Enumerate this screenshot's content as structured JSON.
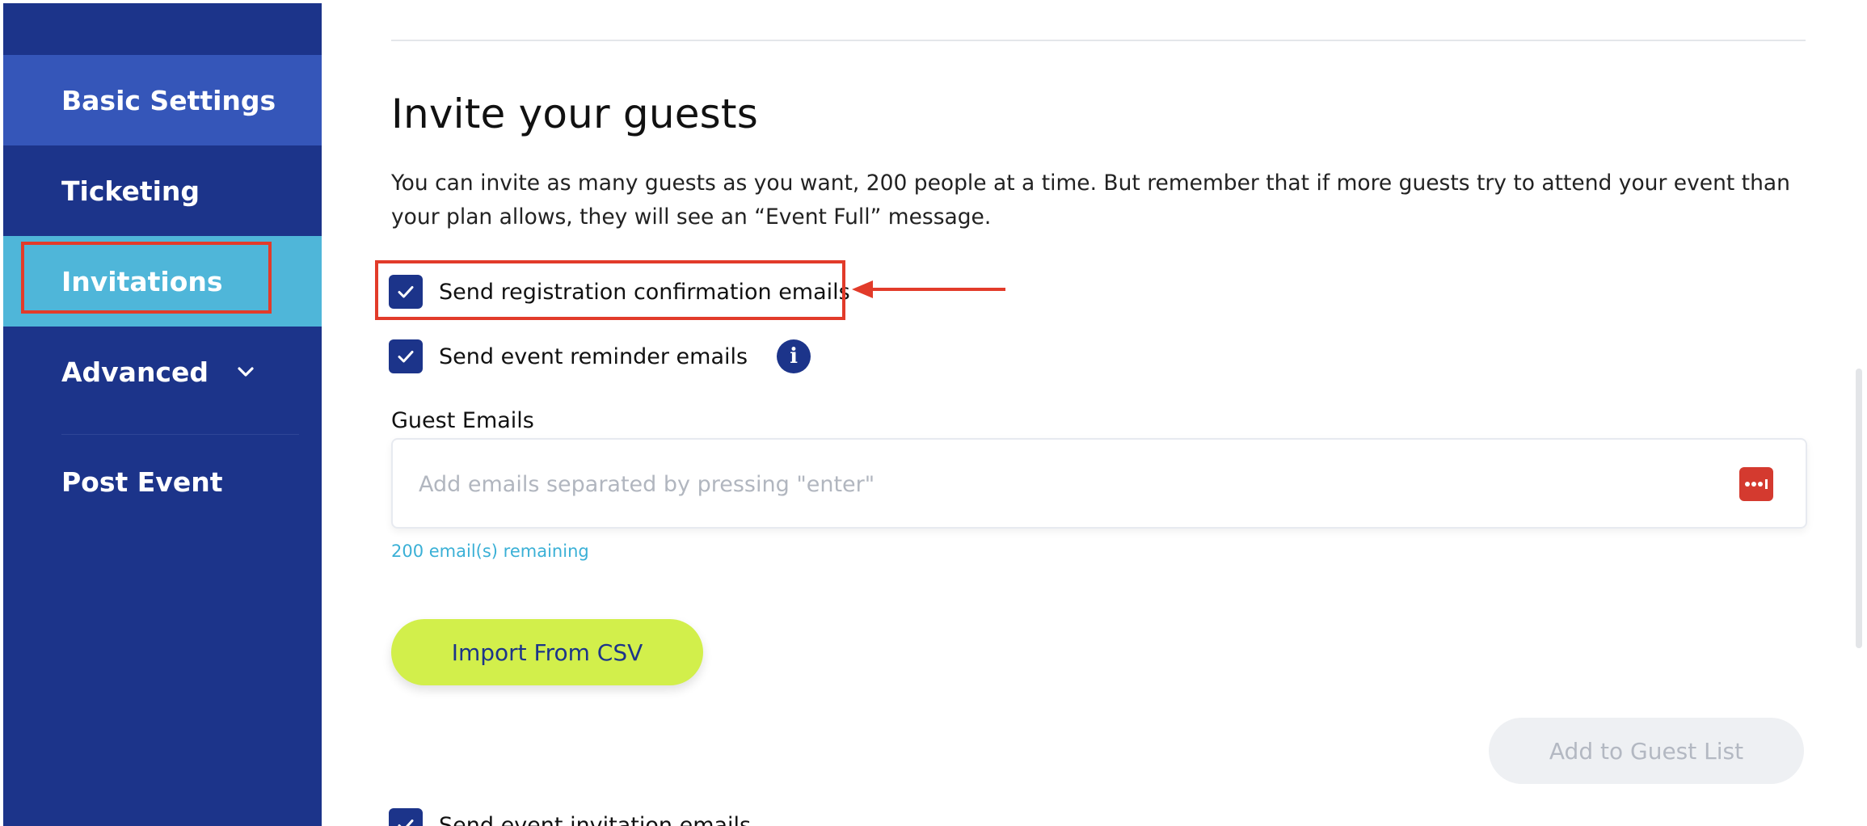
{
  "sidebar": {
    "items": [
      {
        "label": "Basic Settings"
      },
      {
        "label": "Ticketing"
      },
      {
        "label": "Invitations"
      },
      {
        "label": "Advanced"
      },
      {
        "label": "Post Event"
      }
    ],
    "active_item": "Invitations",
    "colors": {
      "background": "#1c348a",
      "basic_settings_bg": "#3556b9",
      "active_bg": "#4fb6d9"
    }
  },
  "main": {
    "title": "Invite your guests",
    "description": "You can invite as many guests as you want, 200 people at a time. But remember that if more guests try to attend your event than your plan allows, they will see an “Event Full” message.",
    "checkboxes": {
      "confirmation": {
        "label": "Send registration confirmation emails",
        "checked": true
      },
      "reminder": {
        "label": "Send event reminder emails",
        "checked": true
      },
      "invitation": {
        "label": "Send event invitation emails",
        "checked": true
      }
    },
    "guest_emails": {
      "label": "Guest Emails",
      "placeholder": "Add emails separated by pressing \"enter\"",
      "value": "",
      "remaining": "200 email(s) remaining"
    },
    "buttons": {
      "import_csv": "Import From CSV",
      "add_to_guest_list": "Add to Guest List"
    }
  },
  "icons": {
    "checkbox": "check-icon",
    "info": "info-icon",
    "chevron": "chevron-down-icon",
    "password_manager": "password-manager-icon"
  },
  "annotation_color": "#e23b2a",
  "accent_colors": {
    "primary": "#1c348a",
    "import_button": "#d2ef4b",
    "remaining_text": "#3ab0d6"
  }
}
